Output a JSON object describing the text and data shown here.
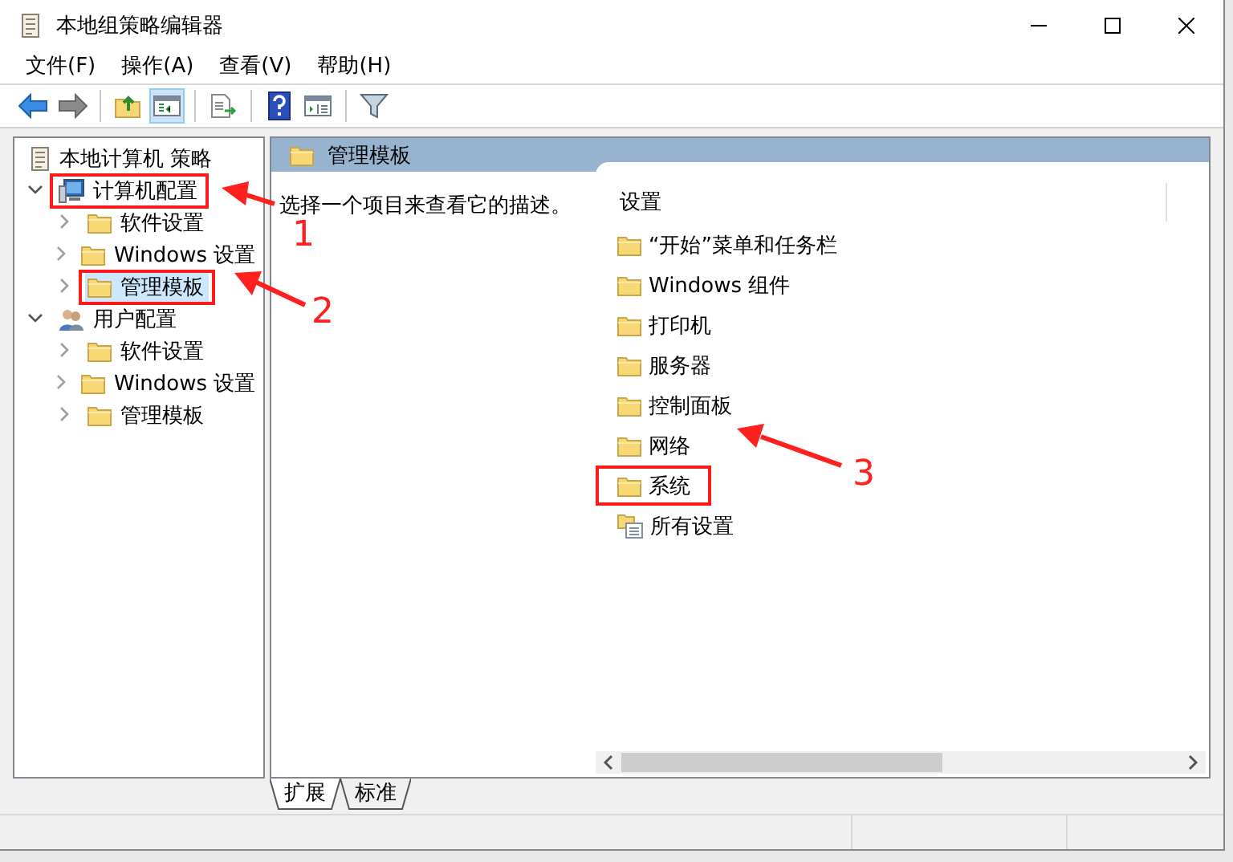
{
  "window": {
    "title": "本地组策略编辑器"
  },
  "menu": [
    {
      "label": "文件(F)"
    },
    {
      "label": "操作(A)"
    },
    {
      "label": "查看(V)"
    },
    {
      "label": "帮助(H)"
    }
  ],
  "tree": [
    {
      "label": "本地计算机 策略",
      "kind": "policy",
      "selected": false,
      "highlighted": false,
      "children": [
        {
          "label": "计算机配置",
          "kind": "computer",
          "expanded": true,
          "selected": false,
          "highlighted": true,
          "children": [
            {
              "label": "软件设置",
              "kind": "folder",
              "expanded": false,
              "selected": false,
              "highlighted": false
            },
            {
              "label": "Windows 设置",
              "kind": "folder",
              "expanded": false,
              "selected": false,
              "highlighted": false
            },
            {
              "label": "管理模板",
              "kind": "folder",
              "expanded": false,
              "selected": true,
              "highlighted": true
            }
          ]
        },
        {
          "label": "用户配置",
          "kind": "user",
          "expanded": true,
          "selected": false,
          "highlighted": false,
          "children": [
            {
              "label": "软件设置",
              "kind": "folder",
              "expanded": false,
              "selected": false,
              "highlighted": false
            },
            {
              "label": "Windows 设置",
              "kind": "folder",
              "expanded": false,
              "selected": false,
              "highlighted": false
            },
            {
              "label": "管理模板",
              "kind": "folder",
              "expanded": false,
              "selected": false,
              "highlighted": false
            }
          ]
        }
      ]
    }
  ],
  "details": {
    "header": "管理模板",
    "description": "选择一个项目来查看它的描述。",
    "column": "设置",
    "items": [
      {
        "label": "“开始”菜单和任务栏",
        "kind": "folder",
        "highlighted": false
      },
      {
        "label": "Windows 组件",
        "kind": "folder",
        "highlighted": false
      },
      {
        "label": "打印机",
        "kind": "folder",
        "highlighted": false
      },
      {
        "label": "服务器",
        "kind": "folder",
        "highlighted": false
      },
      {
        "label": "控制面板",
        "kind": "folder",
        "highlighted": false
      },
      {
        "label": "网络",
        "kind": "folder",
        "highlighted": false
      },
      {
        "label": "系统",
        "kind": "folder",
        "highlighted": true
      },
      {
        "label": "所有设置",
        "kind": "all-settings",
        "highlighted": false
      }
    ]
  },
  "tabs": [
    {
      "label": "扩展",
      "selected": true
    },
    {
      "label": "标准",
      "selected": false
    }
  ],
  "annotations": [
    {
      "label": "1"
    },
    {
      "label": "2"
    },
    {
      "label": "3"
    }
  ]
}
